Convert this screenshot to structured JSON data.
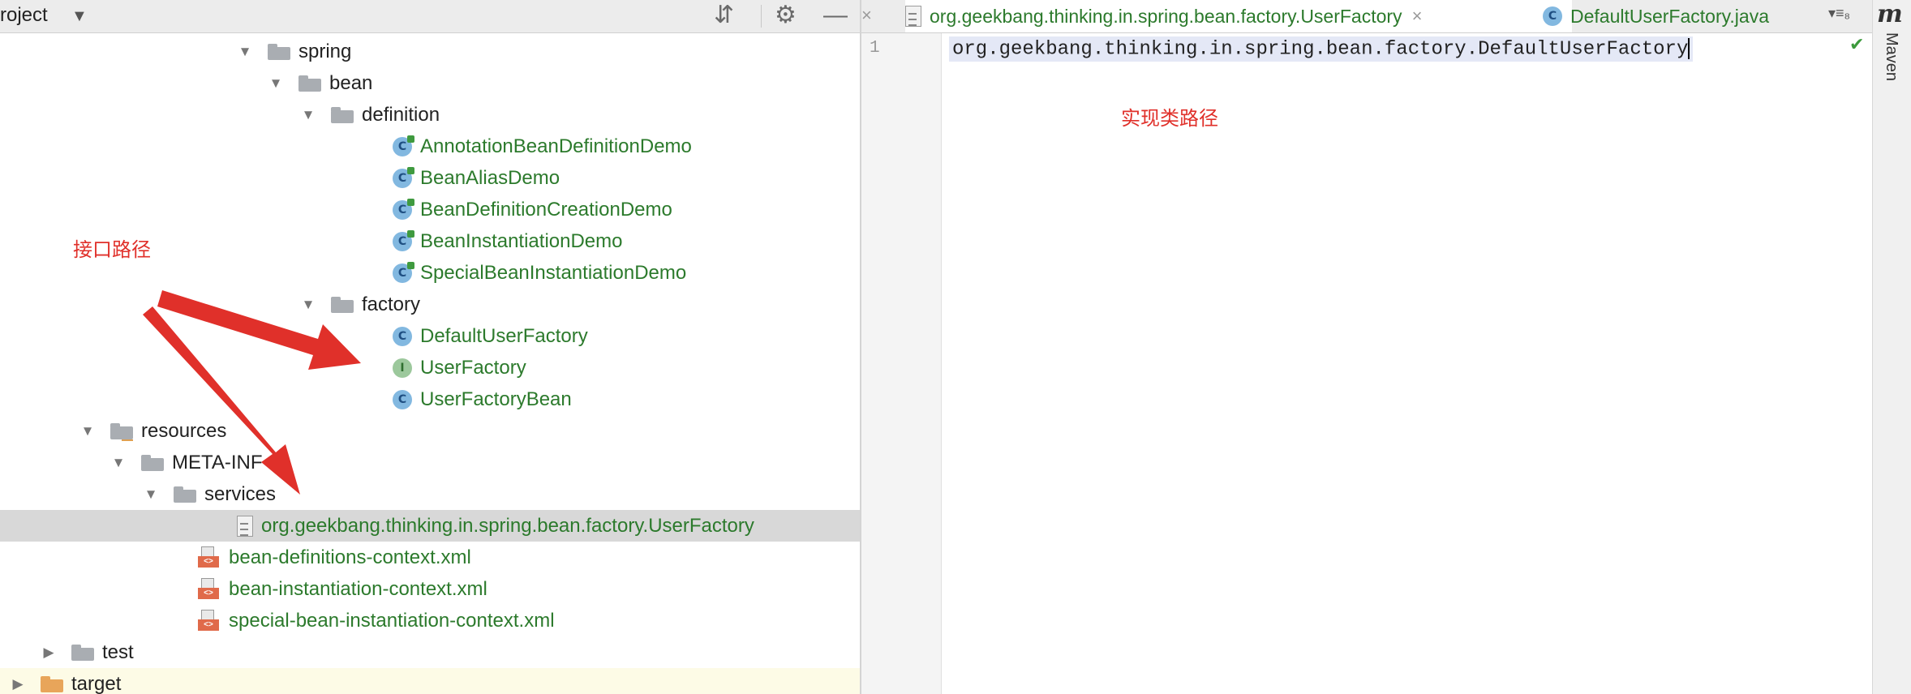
{
  "project_panel": {
    "title": "roject",
    "tree": [
      {
        "label": "spring",
        "arrow": "▼",
        "icon": "folder",
        "green": false
      },
      {
        "label": "bean",
        "arrow": "▼",
        "icon": "folder",
        "green": false
      },
      {
        "label": "definition",
        "arrow": "▼",
        "icon": "folder",
        "green": false
      },
      {
        "label": "AnnotationBeanDefinitionDemo",
        "arrow": "",
        "icon": "class-run",
        "green": true
      },
      {
        "label": "BeanAliasDemo",
        "arrow": "",
        "icon": "class-run",
        "green": true
      },
      {
        "label": "BeanDefinitionCreationDemo",
        "arrow": "",
        "icon": "class-run",
        "green": true
      },
      {
        "label": "BeanInstantiationDemo",
        "arrow": "",
        "icon": "class-run",
        "green": true
      },
      {
        "label": "SpecialBeanInstantiationDemo",
        "arrow": "",
        "icon": "class-run",
        "green": true
      },
      {
        "label": "factory",
        "arrow": "▼",
        "icon": "folder",
        "green": false
      },
      {
        "label": "DefaultUserFactory",
        "arrow": "",
        "icon": "class",
        "green": true
      },
      {
        "label": "UserFactory",
        "arrow": "",
        "icon": "interface",
        "green": true
      },
      {
        "label": "UserFactoryBean",
        "arrow": "",
        "icon": "class",
        "green": true
      },
      {
        "label": "resources",
        "arrow": "▼",
        "icon": "resources-folder",
        "green": false
      },
      {
        "label": "META-INF",
        "arrow": "▼",
        "icon": "folder",
        "green": false
      },
      {
        "label": "services",
        "arrow": "▼",
        "icon": "folder",
        "green": false
      },
      {
        "label": "org.geekbang.thinking.in.spring.bean.factory.UserFactory",
        "arrow": "",
        "icon": "text-file",
        "green": true,
        "selected": true
      },
      {
        "label": "bean-definitions-context.xml",
        "arrow": "",
        "icon": "xml",
        "green": true
      },
      {
        "label": "bean-instantiation-context.xml",
        "arrow": "",
        "icon": "xml",
        "green": true
      },
      {
        "label": "special-bean-instantiation-context.xml",
        "arrow": "",
        "icon": "xml",
        "green": true
      },
      {
        "label": "test",
        "arrow": "▶",
        "icon": "folder",
        "green": false
      },
      {
        "label": "target",
        "arrow": "▶",
        "icon": "orange-folder",
        "green": false
      }
    ]
  },
  "annotations": {
    "interface_path": "接口路径",
    "impl_path": "实现类路径",
    "color": "#e0302a"
  },
  "editor": {
    "tabs": [
      {
        "label": "org.geekbang.thinking.in.spring.bean.factory.UserFactory",
        "icon": "text-file",
        "active": true
      },
      {
        "label": "DefaultUserFactory.java",
        "icon": "class",
        "active": false
      }
    ],
    "tabs_overflow": "▾≡₈",
    "line_number": "1",
    "code": "org.geekbang.thinking.in.spring.bean.factory.DefaultUserFactory",
    "maven_label": "Maven",
    "maven_icon": "m"
  }
}
